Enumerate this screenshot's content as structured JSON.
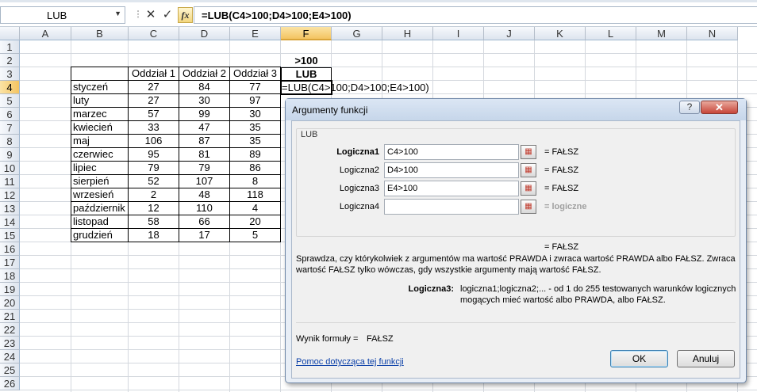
{
  "formula_bar": {
    "name_box": "LUB",
    "cancel_glyph": "✕",
    "enter_glyph": "✓",
    "fx_label": "fx",
    "formula": "=LUB(C4>100;D4>100;E4>100)"
  },
  "grid": {
    "columns": [
      "A",
      "B",
      "C",
      "D",
      "E",
      "F",
      "G",
      "H",
      "I",
      "J",
      "K",
      "L",
      "M",
      "N"
    ],
    "rows": [
      "1",
      "2",
      "3",
      "4",
      "5",
      "6",
      "7",
      "8",
      "9",
      "10",
      "11",
      "12",
      "13",
      "14",
      "15",
      "16",
      "17",
      "18",
      "19",
      "20",
      "21",
      "22",
      "23",
      "24",
      "25",
      "26"
    ],
    "selected_column": "F",
    "selected_row": "4"
  },
  "sheet": {
    "f2": ">100",
    "f3": "LUB",
    "f4": "=LUB(C4>100;D4>100;E4>100)",
    "headers": [
      "Oddział 1",
      "Oddział 2",
      "Oddział 3"
    ],
    "months": [
      "styczeń",
      "luty",
      "marzec",
      "kwiecień",
      "maj",
      "czerwiec",
      "lipiec",
      "sierpień",
      "wrzesień",
      "październik",
      "listopad",
      "grudzień"
    ],
    "c": [
      "27",
      "27",
      "57",
      "33",
      "106",
      "95",
      "79",
      "52",
      "2",
      "12",
      "58",
      "18"
    ],
    "d": [
      "84",
      "30",
      "99",
      "47",
      "87",
      "81",
      "79",
      "107",
      "48",
      "110",
      "66",
      "17"
    ],
    "e": [
      "77",
      "97",
      "30",
      "35",
      "35",
      "89",
      "86",
      "8",
      "118",
      "4",
      "20",
      "5"
    ]
  },
  "dialog": {
    "title": "Argumenty funkcji",
    "help_glyph": "?",
    "close_glyph": "✕",
    "group_label": "LUB",
    "args": [
      {
        "label": "Logiczna1",
        "value": "C4>100",
        "result": "= FAŁSZ"
      },
      {
        "label": "Logiczna2",
        "value": "D4>100",
        "result": "= FAŁSZ"
      },
      {
        "label": "Logiczna3",
        "value": "E4>100",
        "result": "= FAŁSZ"
      },
      {
        "label": "Logiczna4",
        "value": "",
        "result": "= logiczne"
      }
    ],
    "overall_result": "= FAŁSZ",
    "description": "Sprawdza, czy którykolwiek z argumentów ma wartość PRAWDA i zwraca wartość PRAWDA albo FAŁSZ. Zwraca wartość FAŁSZ tylko wówczas, gdy wszystkie argumenty mają wartość FAŁSZ.",
    "arg_help_name": "Logiczna3:",
    "arg_help_text": "logiczna1;logiczna2;... - od 1 do 255 testowanych warunków logicznych mogących mieć wartość albo PRAWDA, albo FAŁSZ.",
    "formula_result_label": "Wynik formuły =",
    "formula_result_value": "FAŁSZ",
    "help_link": "Pomoc dotycząca tej funkcji",
    "ok": "OK",
    "cancel": "Anuluj"
  }
}
